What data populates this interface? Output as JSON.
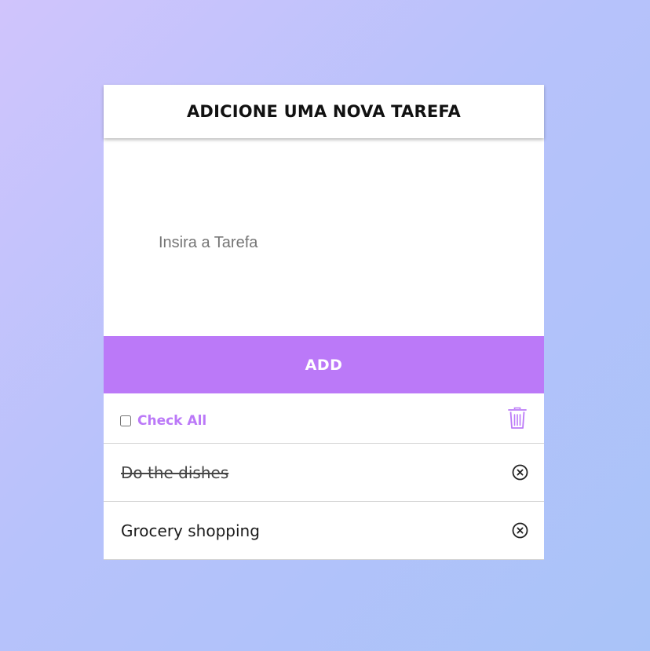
{
  "header": {
    "title": "ADICIONE UMA NOVA TAREFA"
  },
  "task_input": {
    "placeholder": "Insira a Tarefa",
    "value": ""
  },
  "add_button": {
    "label": "ADD"
  },
  "toolbar": {
    "check_all_label": "Check All",
    "check_all_checked": false,
    "delete_icon": "trash-icon"
  },
  "tasks": [
    {
      "text": "Do the dishes",
      "completed": true,
      "remove_icon": "circle-x-icon"
    },
    {
      "text": "Grocery shopping",
      "completed": false,
      "remove_icon": "circle-x-icon"
    }
  ],
  "colors": {
    "accent": "#bb79f8",
    "background_start": "#d0c4fc",
    "background_end": "#a9c3f8"
  }
}
